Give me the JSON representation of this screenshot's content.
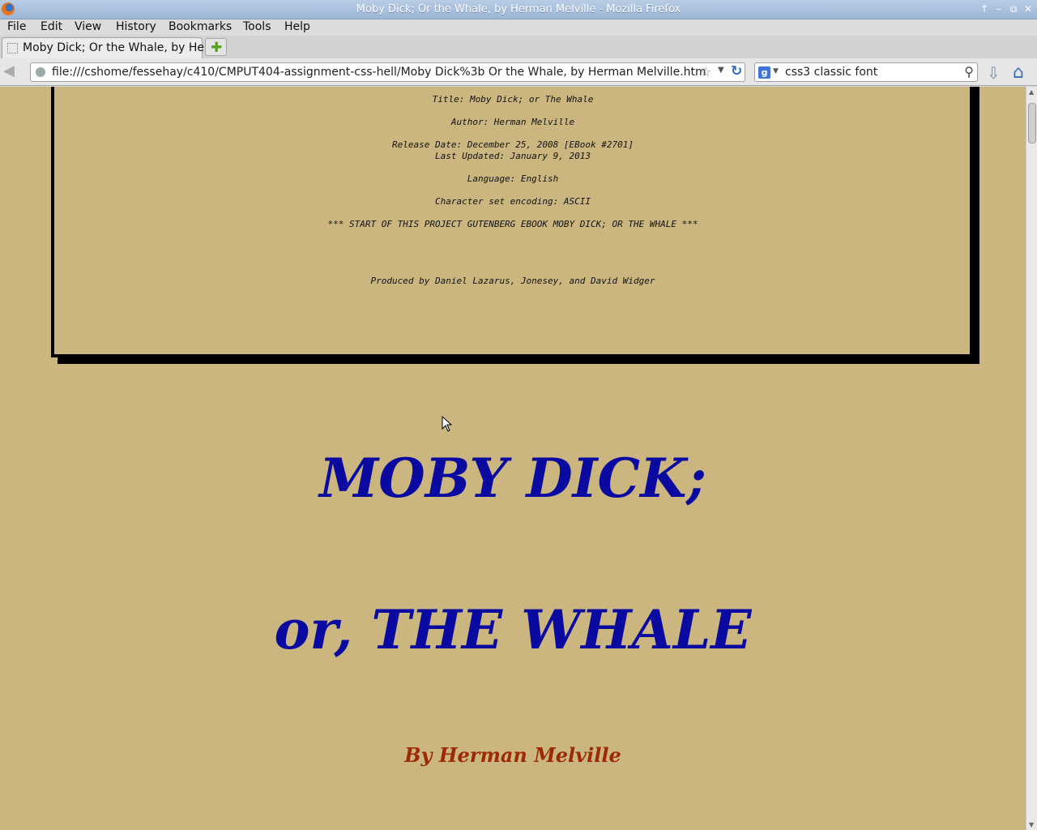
{
  "window": {
    "title": "Moby Dick; Or the Whale, by Herman Melville - Mozilla Firefox",
    "controls": [
      "↑",
      "–",
      "⧉",
      "✕"
    ]
  },
  "menu": {
    "file": "File",
    "edit": "Edit",
    "view": "View",
    "history": "History",
    "bookmarks": "Bookmarks",
    "tools": "Tools",
    "help": "Help"
  },
  "tabs": [
    {
      "label": "Moby Dick; Or the Whale, by He..."
    }
  ],
  "navbar": {
    "url": "file:///cshome/fessehay/c410/CMPUT404-assignment-css-hell/Moby Dick%3b Or the Whale, by Herman Melville.htm",
    "search_query": "css3 classic font",
    "search_engine_icon": "g"
  },
  "page": {
    "header_lines": {
      "title": "Title: Moby Dick; or The Whale",
      "author": "Author: Herman Melville",
      "release": "Release Date: December 25, 2008 [EBook #2701]",
      "updated": "Last Updated: January 9, 2013",
      "language": "Language: English",
      "encoding": "Character set encoding: ASCII",
      "start": "*** START OF THIS PROJECT GUTENBERG EBOOK MOBY DICK; OR THE WHALE ***",
      "produced": "Produced by Daniel Lazarus, Jonesey, and David Widger"
    },
    "book_title_1": "MOBY DICK;",
    "book_title_2": "or, THE WHALE",
    "book_author": "By Herman Melville"
  },
  "colors": {
    "page_background": "#cbb680",
    "title_color": "#0a0aa0",
    "author_color": "#9b2a05"
  }
}
